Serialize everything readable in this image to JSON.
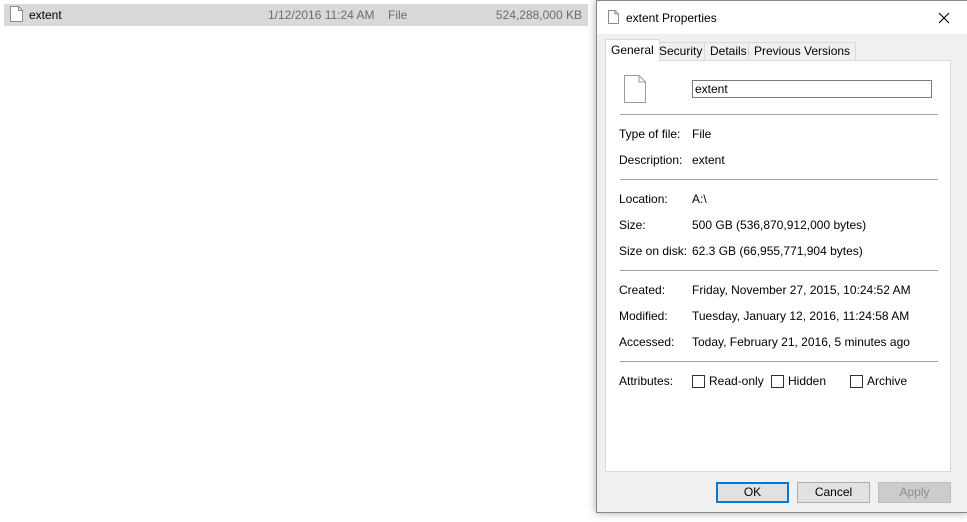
{
  "explorer": {
    "row": {
      "name": "extent",
      "date": "1/12/2016 11:24 AM",
      "type": "File",
      "size": "524,288,000 KB"
    }
  },
  "dialog": {
    "title": "extent Properties",
    "tabs": [
      "General",
      "Security",
      "Details",
      "Previous Versions"
    ],
    "active_tab": "General",
    "file_name": "extent",
    "fields": {
      "type_label": "Type of file:",
      "type_value": "File",
      "description_label": "Description:",
      "description_value": "extent",
      "location_label": "Location:",
      "location_value": "A:\\",
      "size_label": "Size:",
      "size_value": "500 GB (536,870,912,000 bytes)",
      "size_on_disk_label": "Size on disk:",
      "size_on_disk_value": "62.3 GB (66,955,771,904 bytes)",
      "created_label": "Created:",
      "created_value": "Friday, November 27, 2015, 10:24:52 AM",
      "modified_label": "Modified:",
      "modified_value": "Tuesday, January 12, 2016, 11:24:58 AM",
      "accessed_label": "Accessed:",
      "accessed_value": "Today, February 21, 2016, 5 minutes ago",
      "attributes_label": "Attributes:"
    },
    "attributes": [
      {
        "label": "Read-only",
        "checked": false
      },
      {
        "label": "Hidden",
        "checked": false
      },
      {
        "label": "Archive",
        "checked": false
      }
    ],
    "buttons": {
      "ok": "OK",
      "cancel": "Cancel",
      "apply": "Apply"
    }
  },
  "icons": {
    "file": "file-icon",
    "close": "close-icon"
  },
  "colors": {
    "selection": "#d9d9d9",
    "dialog_bg": "#f0f0f0",
    "accent": "#0078d7"
  }
}
